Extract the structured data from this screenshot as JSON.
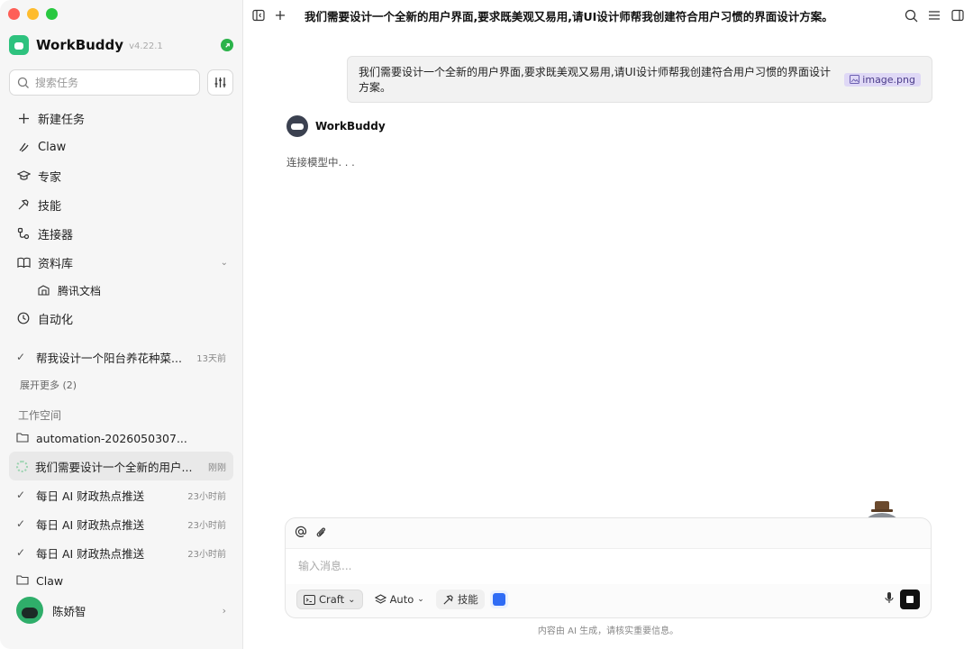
{
  "brand": {
    "name": "WorkBuddy",
    "version": "v4.22.1"
  },
  "search": {
    "placeholder": "搜索任务"
  },
  "nav": {
    "new_task": "新建任务",
    "claw": "Claw",
    "expert": "专家",
    "skills": "技能",
    "connectors": "连接器",
    "library": "资料库",
    "tencent_docs": "腾讯文档",
    "automation": "自动化"
  },
  "recent": {
    "tasks": [
      {
        "title": "帮我设计一个阳台养花种菜...",
        "time": "13天前"
      }
    ],
    "expand_more": "展开更多 (2)"
  },
  "workspace": {
    "label": "工作空间",
    "folder": "automation-2026050307...",
    "active_task": {
      "title": "我们需要设计一个全新的用户...",
      "time": "刚刚"
    },
    "tasks": [
      {
        "title": "每日 AI 财政热点推送",
        "time": "23小时前"
      },
      {
        "title": "每日 AI 财政热点推送",
        "time": "23小时前"
      },
      {
        "title": "每日 AI 财政热点推送",
        "time": "23小时前"
      }
    ],
    "claw_folder": "Claw"
  },
  "user": {
    "name": "陈娇智"
  },
  "chat": {
    "title": "我们需要设计一个全新的用户界面,要求既美观又易用,请UI设计师帮我创建符合用户习惯的界面设计方案。",
    "user_message": "我们需要设计一个全新的用户界面,要求既美观又易用,请UI设计师帮我创建符合用户习惯的界面设计方案。",
    "attachment": "image.png",
    "bot_name": "WorkBuddy",
    "bot_status": "连接模型中. . ."
  },
  "composer": {
    "placeholder": "输入消息...",
    "mode": "Craft",
    "model": "Auto",
    "skills": "技能"
  },
  "footer_note": "内容由 AI 生成，请核实重要信息。",
  "colors": {
    "brand_green": "#2ec27e",
    "attachment_chip": "#dfd8f6",
    "stop": "#111111"
  }
}
